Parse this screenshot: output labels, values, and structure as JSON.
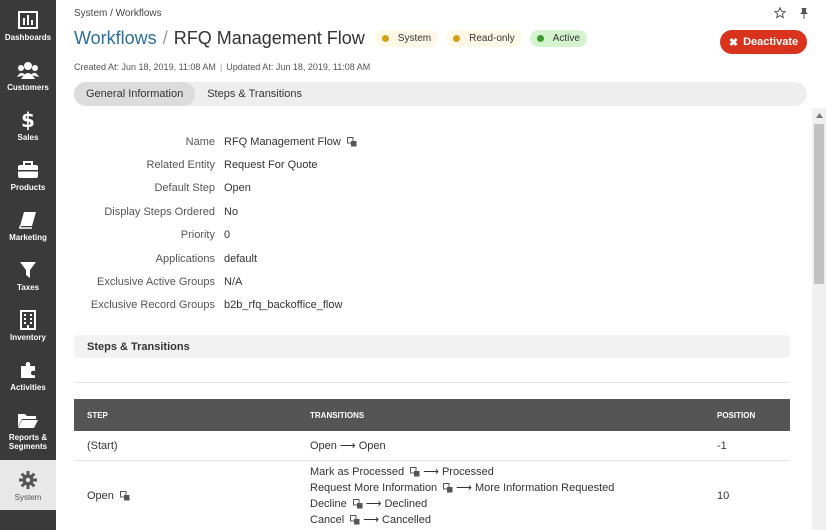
{
  "sidebar": {
    "items": [
      {
        "label": "Dashboards",
        "icon": "bar-chart-icon"
      },
      {
        "label": "Customers",
        "icon": "users-icon"
      },
      {
        "label": "Sales",
        "icon": "dollar-icon"
      },
      {
        "label": "Products",
        "icon": "briefcase-icon"
      },
      {
        "label": "Marketing",
        "icon": "book-icon"
      },
      {
        "label": "Taxes",
        "icon": "filter-icon"
      },
      {
        "label": "Inventory",
        "icon": "building-icon"
      },
      {
        "label": "Activities",
        "icon": "puzzle-icon"
      },
      {
        "label": "Reports & Segments",
        "icon": "folder-icon"
      },
      {
        "label": "System",
        "icon": "gear-icon",
        "active": true
      }
    ]
  },
  "breadcrumb": "System / Workflows",
  "title": {
    "link": "Workflows",
    "separator": "/",
    "name": "RFQ Management Flow"
  },
  "badges": {
    "system": "System",
    "readonly": "Read-only",
    "active": "Active"
  },
  "actions": {
    "deactivate": "Deactivate"
  },
  "meta": {
    "created": "Created At: Jun 18, 2019, 11:08 AM",
    "pipe": "|",
    "updated": "Updated At: Jun 18, 2019, 11:08 AM"
  },
  "tabs": {
    "general": "General Information",
    "steps": "Steps & Transitions"
  },
  "fields": [
    {
      "label": "Name",
      "value": "RFQ Management Flow",
      "translatable": true
    },
    {
      "label": "Related Entity",
      "value": "Request For Quote"
    },
    {
      "label": "Default Step",
      "value": "Open"
    },
    {
      "label": "Display Steps Ordered",
      "value": "No"
    },
    {
      "label": "Priority",
      "value": "0"
    },
    {
      "label": "Applications",
      "value": "default"
    },
    {
      "label": "Exclusive Active Groups",
      "value": "N/A"
    },
    {
      "label": "Exclusive Record Groups",
      "value": "b2b_rfq_backoffice_flow"
    }
  ],
  "section": {
    "title": "Steps & Transitions"
  },
  "table": {
    "headers": {
      "step": "STEP",
      "transitions": "TRANSITIONS",
      "position": "POSITION"
    },
    "rows": [
      {
        "step": "(Start)",
        "transitions": [
          {
            "name": "Open",
            "target": "Open"
          }
        ],
        "position": "-1"
      },
      {
        "step": "Open",
        "transitions": [
          {
            "name": "Mark as Processed",
            "target": "Processed"
          },
          {
            "name": "Request More Information",
            "target": "More Information Requested"
          },
          {
            "name": "Decline",
            "target": "Declined"
          },
          {
            "name": "Cancel",
            "target": "Cancelled"
          }
        ],
        "position": "10"
      }
    ],
    "arrow": "⟶"
  },
  "colors": {
    "sidebar": "#3a3a3a",
    "link": "#2c6e9b",
    "danger": "#d9321d",
    "table_header": "#555555"
  }
}
